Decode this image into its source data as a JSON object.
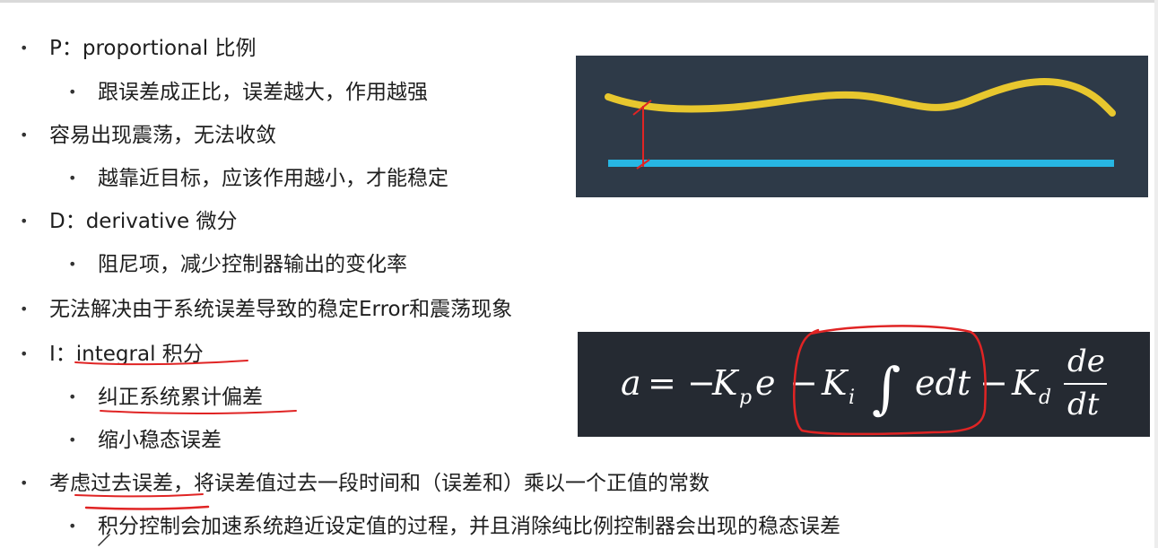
{
  "bullets": [
    {
      "level": 1,
      "text": "P：proportional 比例"
    },
    {
      "level": 2,
      "text": "跟误差成正比，误差越大，作用越强"
    },
    {
      "level": 1,
      "text": "容易出现震荡，无法收敛"
    },
    {
      "level": 2,
      "text": "越靠近目标，应该作用越小，才能稳定"
    },
    {
      "level": 1,
      "text": "D：derivative 微分"
    },
    {
      "level": 2,
      "text": "阻尼项，减少控制器输出的变化率"
    },
    {
      "level": 1,
      "text": "无法解决由于系统误差导致的稳定Error和震荡现象"
    },
    {
      "level": 1,
      "text": "I：integral 积分"
    },
    {
      "level": 2,
      "text": "纠正系统累计偏差"
    },
    {
      "level": 2,
      "text": "缩小稳态误差"
    },
    {
      "level": 1,
      "text": "考虑过去误差，将误差值过去一段时间和（误差和）乘以一个正值的常数"
    },
    {
      "level": 2,
      "text": "积分控制会加速系统趋近设定值的过程，并且消除纯比例控制器会出现的稳态误差"
    }
  ],
  "formula": {
    "a": "a",
    "eq": "=",
    "minus": "−",
    "kp": "K",
    "kp_sub": "p",
    "e": "e",
    "ki": "K",
    "ki_sub": "i",
    "integral": "∫",
    "edt": "edt",
    "kd": "K",
    "kd_sub": "d",
    "frac_num": "de",
    "frac_den": "dt"
  },
  "colors": {
    "wave_panel_bg": "#2e3a48",
    "formula_panel_bg": "#252a32",
    "actual_curve": "#e8c72e",
    "target_line": "#27b6e3",
    "annotation_ink": "#e02424"
  }
}
